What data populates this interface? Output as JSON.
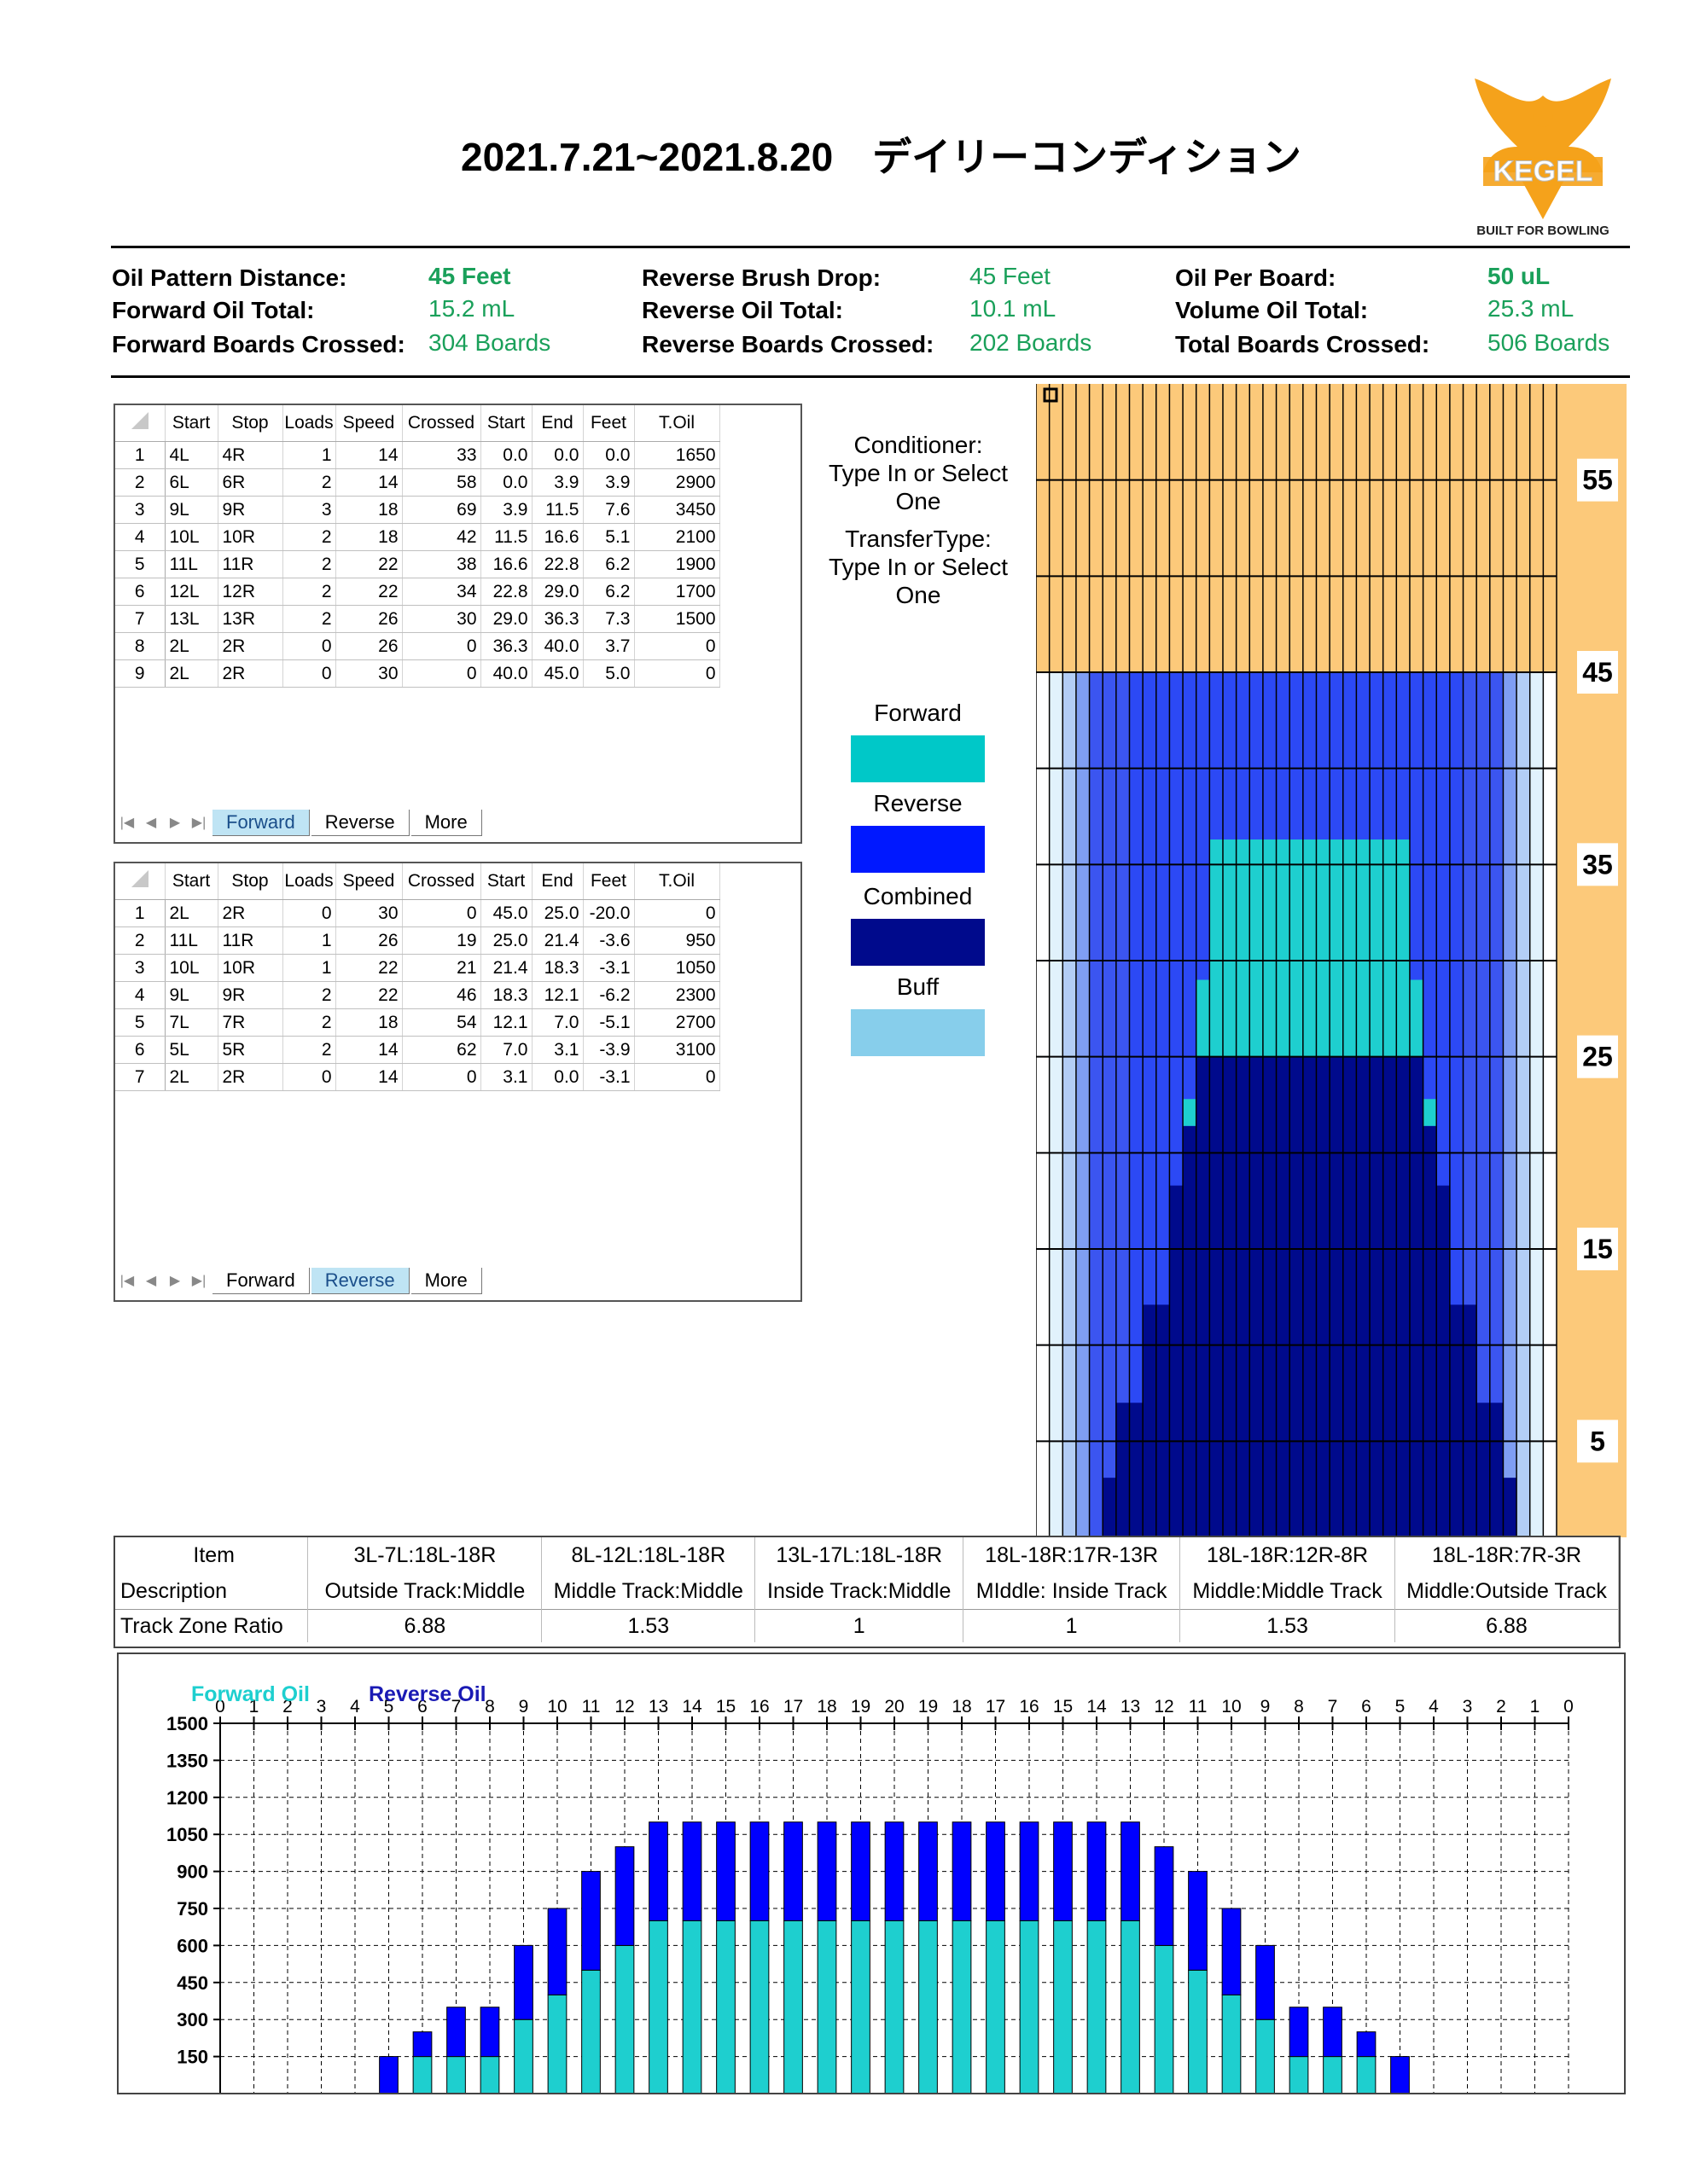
{
  "header": {
    "title": "2021.7.21~2021.8.20　デイリーコンディション",
    "logo_text": "KEGEL",
    "logo_tagline": "BUILT FOR BOWLING"
  },
  "summary": {
    "col1": [
      {
        "label": "Oil Pattern Distance:",
        "value": "45 Feet",
        "bold": true
      },
      {
        "label": "Forward Oil Total:",
        "value": "15.2 mL",
        "bold": false
      },
      {
        "label": "Forward Boards Crossed:",
        "value": "304 Boards",
        "bold": false
      }
    ],
    "col2": [
      {
        "label": "Reverse Brush Drop:",
        "value": "45 Feet",
        "bold": false
      },
      {
        "label": "Reverse Oil Total:",
        "value": "10.1 mL",
        "bold": false
      },
      {
        "label": "Reverse Boards Crossed:",
        "value": "202 Boards",
        "bold": false
      }
    ],
    "col3": [
      {
        "label": "Oil Per Board:",
        "value": "50 uL",
        "bold": true
      },
      {
        "label": "Volume Oil Total:",
        "value": "25.3 mL",
        "bold": false
      },
      {
        "label": "Total Boards Crossed:",
        "value": "506 Boards",
        "bold": false
      }
    ]
  },
  "sheets": {
    "columns": [
      "Start",
      "Stop",
      "Loads",
      "Speed",
      "Crossed",
      "Start",
      "End",
      "Feet",
      "T.Oil"
    ],
    "tabs": [
      "Forward",
      "Reverse",
      "More"
    ],
    "forward_rows": [
      [
        "1",
        "4L",
        "4R",
        "1",
        "14",
        "33",
        "0.0",
        "0.0",
        "0.0",
        "1650"
      ],
      [
        "2",
        "6L",
        "6R",
        "2",
        "14",
        "58",
        "0.0",
        "3.9",
        "3.9",
        "2900"
      ],
      [
        "3",
        "9L",
        "9R",
        "3",
        "18",
        "69",
        "3.9",
        "11.5",
        "7.6",
        "3450"
      ],
      [
        "4",
        "10L",
        "10R",
        "2",
        "18",
        "42",
        "11.5",
        "16.6",
        "5.1",
        "2100"
      ],
      [
        "5",
        "11L",
        "11R",
        "2",
        "22",
        "38",
        "16.6",
        "22.8",
        "6.2",
        "1900"
      ],
      [
        "6",
        "12L",
        "12R",
        "2",
        "22",
        "34",
        "22.8",
        "29.0",
        "6.2",
        "1700"
      ],
      [
        "7",
        "13L",
        "13R",
        "2",
        "26",
        "30",
        "29.0",
        "36.3",
        "7.3",
        "1500"
      ],
      [
        "8",
        "2L",
        "2R",
        "0",
        "26",
        "0",
        "36.3",
        "40.0",
        "3.7",
        "0"
      ],
      [
        "9",
        "2L",
        "2R",
        "0",
        "30",
        "0",
        "40.0",
        "45.0",
        "5.0",
        "0"
      ]
    ],
    "reverse_rows": [
      [
        "1",
        "2L",
        "2R",
        "0",
        "30",
        "0",
        "45.0",
        "25.0",
        "-20.0",
        "0"
      ],
      [
        "2",
        "11L",
        "11R",
        "1",
        "26",
        "19",
        "25.0",
        "21.4",
        "-3.6",
        "950"
      ],
      [
        "3",
        "10L",
        "10R",
        "1",
        "22",
        "21",
        "21.4",
        "18.3",
        "-3.1",
        "1050"
      ],
      [
        "4",
        "9L",
        "9R",
        "2",
        "22",
        "46",
        "18.3",
        "12.1",
        "-6.2",
        "2300"
      ],
      [
        "5",
        "7L",
        "7R",
        "2",
        "18",
        "54",
        "12.1",
        "7.0",
        "-5.1",
        "2700"
      ],
      [
        "6",
        "5L",
        "5R",
        "2",
        "14",
        "62",
        "7.0",
        "3.1",
        "-3.9",
        "3100"
      ],
      [
        "7",
        "2L",
        "2R",
        "0",
        "14",
        "0",
        "3.1",
        "0.0",
        "-3.1",
        "0"
      ]
    ]
  },
  "conditioner": {
    "conditioner_label": "Conditioner:",
    "conditioner_value": "Type In or Select One",
    "transfer_label": "TransferType:",
    "transfer_value": "Type In or Select One"
  },
  "legend": [
    {
      "name": "Forward",
      "color": "#00c8c8"
    },
    {
      "name": "Reverse",
      "color": "#0018ff"
    },
    {
      "name": "Combined",
      "color": "#000a8c"
    },
    {
      "name": "Buff",
      "color": "#87ceeb"
    }
  ],
  "lane_map": {
    "ruler_labels": [
      "55",
      "45",
      "35",
      "25",
      "15",
      "5"
    ],
    "pattern_length": 45,
    "top_feet": 60
  },
  "zone_table": {
    "row_labels": [
      "Item",
      "Description",
      "Track Zone Ratio"
    ],
    "items": [
      "3L-7L:18L-18R",
      "8L-12L:18L-18R",
      "13L-17L:18L-18R",
      "18L-18R:17R-13R",
      "18L-18R:12R-8R",
      "18L-18R:7R-3R"
    ],
    "descriptions": [
      "Outside Track:Middle",
      "Middle Track:Middle",
      "Inside Track:Middle",
      "MIddle: Inside Track",
      "Middle:Middle Track",
      "Middle:Outside Track"
    ],
    "ratios": [
      "6.88",
      "1.53",
      "1",
      "1",
      "1.53",
      "6.88"
    ]
  },
  "chart_data": {
    "type": "bar",
    "stacked": true,
    "categories": [
      "0",
      "1",
      "2",
      "3",
      "4",
      "5",
      "6",
      "7",
      "8",
      "9",
      "10",
      "11",
      "12",
      "13",
      "14",
      "15",
      "16",
      "17",
      "18",
      "19",
      "20",
      "19",
      "18",
      "17",
      "16",
      "15",
      "14",
      "13",
      "12",
      "11",
      "10",
      "9",
      "8",
      "7",
      "6",
      "5",
      "4",
      "3",
      "2",
      "1",
      "0"
    ],
    "series": [
      {
        "name": "Forward Oil",
        "color": "#1ecfcf",
        "values": [
          0,
          0,
          0,
          0,
          0,
          0,
          150,
          150,
          150,
          300,
          400,
          500,
          600,
          700,
          700,
          700,
          700,
          700,
          700,
          700,
          700,
          700,
          700,
          700,
          700,
          700,
          700,
          700,
          600,
          500,
          400,
          300,
          150,
          150,
          150,
          0,
          0,
          0,
          0,
          0,
          0
        ]
      },
      {
        "name": "Reverse Oil",
        "color": "#0000ff",
        "values": [
          0,
          0,
          0,
          0,
          0,
          150,
          100,
          200,
          200,
          300,
          350,
          400,
          400,
          400,
          400,
          400,
          400,
          400,
          400,
          400,
          400,
          400,
          400,
          400,
          400,
          400,
          400,
          400,
          400,
          400,
          350,
          300,
          200,
          200,
          100,
          150,
          0,
          0,
          0,
          0,
          0
        ]
      }
    ],
    "yticks": [
      150,
      300,
      450,
      600,
      750,
      900,
      1050,
      1200,
      1350,
      1500
    ],
    "ylim": [
      0,
      1500
    ],
    "grid": true,
    "legend_position": "top-left"
  }
}
